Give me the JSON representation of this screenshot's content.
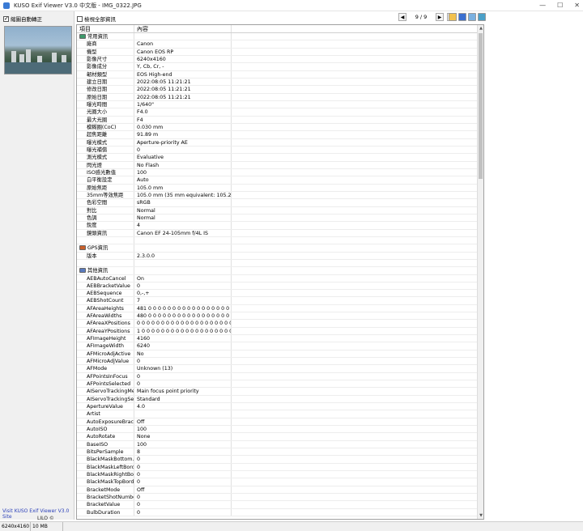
{
  "window": {
    "title": "KUSO Exif Viewer V3.0 中文版 - IMG_0322.JPG",
    "controls": [
      "—",
      "☐",
      "✕"
    ]
  },
  "left_panel": {
    "auto_rotate_label": "縮圖自動轉正",
    "site_link": "Visit KUSO Exif Viewer V3.0 Site",
    "credit": "LILO © KUSO.CC"
  },
  "toolbar": {
    "show_all_label": "檢視全部資訊",
    "page_count": "9 / 9",
    "prev": "◀",
    "next": "▶",
    "last": "▶|"
  },
  "grid": {
    "col_item": "項目",
    "col_content": "內容",
    "rows": [
      {
        "type": "section",
        "icon": "camera",
        "label": "常用資訊",
        "value": ""
      },
      {
        "label": "廠商",
        "value": "Canon"
      },
      {
        "label": "機型",
        "value": "Canon EOS RP"
      },
      {
        "label": "影像尺寸",
        "value": "6240x4160"
      },
      {
        "label": "影像成分",
        "value": "Y, Cb, Cr, -"
      },
      {
        "label": "韌材類型",
        "value": "EOS High-end"
      },
      {
        "label": "建立日期",
        "value": "2022:08:05 11:21:21"
      },
      {
        "label": "修改日期",
        "value": "2022:08:05 11:21:21"
      },
      {
        "label": "原始日期",
        "value": "2022:08:05 11:21:21"
      },
      {
        "label": "曝光時間",
        "value": "1/640\""
      },
      {
        "label": "光圈大小",
        "value": "F4.0"
      },
      {
        "label": "最大光圈",
        "value": "F4"
      },
      {
        "label": "模糊圈(CoC)",
        "value": "0.030 mm"
      },
      {
        "label": "超焦距離",
        "value": "91.89 m"
      },
      {
        "label": "曝光模式",
        "value": "Aperture-priority AE"
      },
      {
        "label": "曝光補償",
        "value": "0"
      },
      {
        "label": "測光模式",
        "value": "Evaluative"
      },
      {
        "label": "閃光燈",
        "value": "No Flash"
      },
      {
        "label": "ISO感光數值",
        "value": "100"
      },
      {
        "label": "白平衡設定",
        "value": "Auto"
      },
      {
        "label": "原始焦距",
        "value": "105.0 mm"
      },
      {
        "label": "35mm等效焦距",
        "value": "105.0 mm (35 mm equivalent: 105.2 mm)"
      },
      {
        "label": "色彩空間",
        "value": "sRGB"
      },
      {
        "label": "對比",
        "value": "Normal"
      },
      {
        "label": "色調",
        "value": "Normal"
      },
      {
        "label": "銳度",
        "value": "4"
      },
      {
        "label": "鏡頭資訊",
        "value": "Canon EF 24-105mm f/4L IS"
      },
      {
        "label": "",
        "value": ""
      },
      {
        "type": "section",
        "icon": "gps",
        "label": "GPS資訊",
        "value": ""
      },
      {
        "label": "版本",
        "value": "2.3.0.0"
      },
      {
        "label": "",
        "value": ""
      },
      {
        "type": "section",
        "icon": "other",
        "label": "其他資訊",
        "value": ""
      },
      {
        "label": "AEBAutoCancel",
        "value": "On"
      },
      {
        "label": "AEBBracketValue",
        "value": "0"
      },
      {
        "label": "AEBSequence",
        "value": "0,-,+"
      },
      {
        "label": "AEBShotCount",
        "value": "7"
      },
      {
        "label": "AFAreaHeights",
        "value": "481 0 0 0 0 0 0 0 0 0 0 0 0 0 0 0 0 0 0 0 0 ..."
      },
      {
        "label": "AFAreaWidths",
        "value": "480 0 0 0 0 0 0 0 0 0 0 0 0 0 0 0 0 0 0 0 0 ..."
      },
      {
        "label": "AFAreaXPositions",
        "value": "0 0 0 0 0 0 0 0 0 0 0 0 0 0 0 0 0 0 0 0 0 0 ..."
      },
      {
        "label": "AFAreaYPositions",
        "value": "1 0 0 0 0 0 0 0 0 0 0 0 0 0 0 0 0 0 0 0 0 0 ..."
      },
      {
        "label": "AFImageHeight",
        "value": "4160"
      },
      {
        "label": "AFImageWidth",
        "value": "6240"
      },
      {
        "label": "AFMicroAdjActive",
        "value": "No"
      },
      {
        "label": "AFMicroAdjValue",
        "value": "0"
      },
      {
        "label": "AFMode",
        "value": "Unknown (13)"
      },
      {
        "label": "AFPointsInFocus",
        "value": "0"
      },
      {
        "label": "AFPointsSelected",
        "value": "0"
      },
      {
        "label": "AIServoTrackingMe...",
        "value": "Main focus point priority"
      },
      {
        "label": "AIServoTrackingSe...",
        "value": "Standard"
      },
      {
        "label": "ApertureValue",
        "value": "4.0"
      },
      {
        "label": "Artist",
        "value": ""
      },
      {
        "label": "AutoExposureBrac...",
        "value": "Off"
      },
      {
        "label": "AutoISO",
        "value": "100"
      },
      {
        "label": "AutoRotate",
        "value": "None"
      },
      {
        "label": "BaseISO",
        "value": "100"
      },
      {
        "label": "BitsPerSample",
        "value": "8"
      },
      {
        "label": "BlackMaskBottom...",
        "value": "0"
      },
      {
        "label": "BlackMaskLeftBorder",
        "value": "0"
      },
      {
        "label": "BlackMaskRightBo...",
        "value": "0"
      },
      {
        "label": "BlackMaskTopBorder",
        "value": "0"
      },
      {
        "label": "BracketMode",
        "value": "Off"
      },
      {
        "label": "BracketShotNumber",
        "value": "0"
      },
      {
        "label": "BracketValue",
        "value": "0"
      },
      {
        "label": "BulbDuration",
        "value": "0"
      }
    ]
  },
  "statusbar": {
    "dimensions": "6240x4160",
    "size": "10 MB"
  }
}
